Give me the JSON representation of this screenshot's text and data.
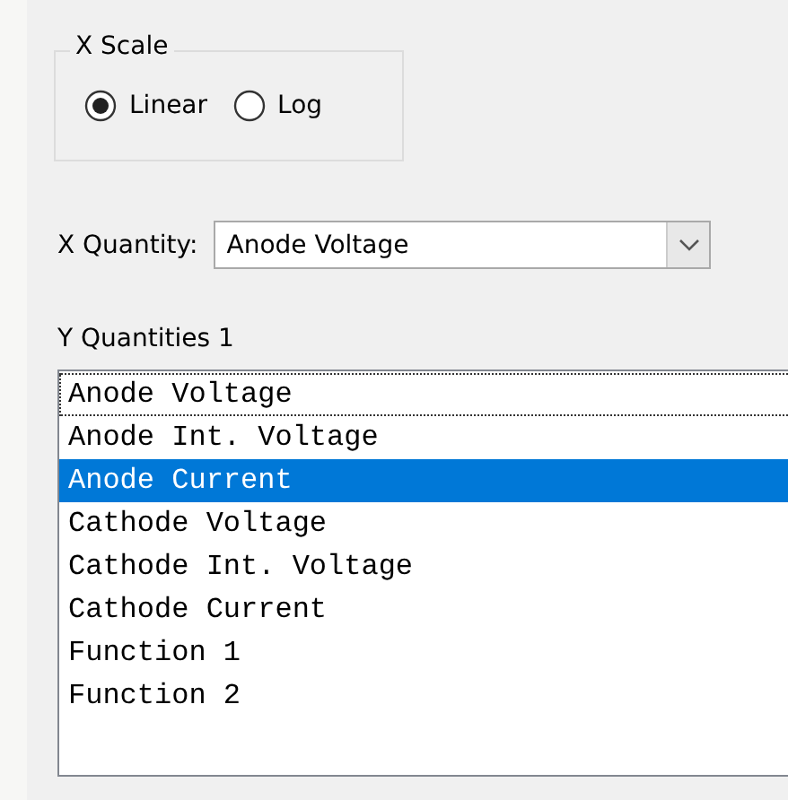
{
  "x_scale": {
    "title": "X Scale",
    "options": [
      {
        "label": "Linear",
        "selected": true
      },
      {
        "label": "Log",
        "selected": false
      }
    ]
  },
  "x_quantity": {
    "label": "X Quantity:",
    "value": "Anode Voltage"
  },
  "y_quantities": {
    "label": "Y Quantities 1",
    "items": [
      {
        "label": "Anode Voltage",
        "selected": false,
        "focused": true
      },
      {
        "label": "Anode Int. Voltage",
        "selected": false,
        "focused": false
      },
      {
        "label": "Anode Current",
        "selected": true,
        "focused": false
      },
      {
        "label": "Cathode Voltage",
        "selected": false,
        "focused": false
      },
      {
        "label": "Cathode Int. Voltage",
        "selected": false,
        "focused": false
      },
      {
        "label": "Cathode Current",
        "selected": false,
        "focused": false
      },
      {
        "label": "Function 1",
        "selected": false,
        "focused": false
      },
      {
        "label": "Function 2",
        "selected": false,
        "focused": false
      }
    ]
  }
}
